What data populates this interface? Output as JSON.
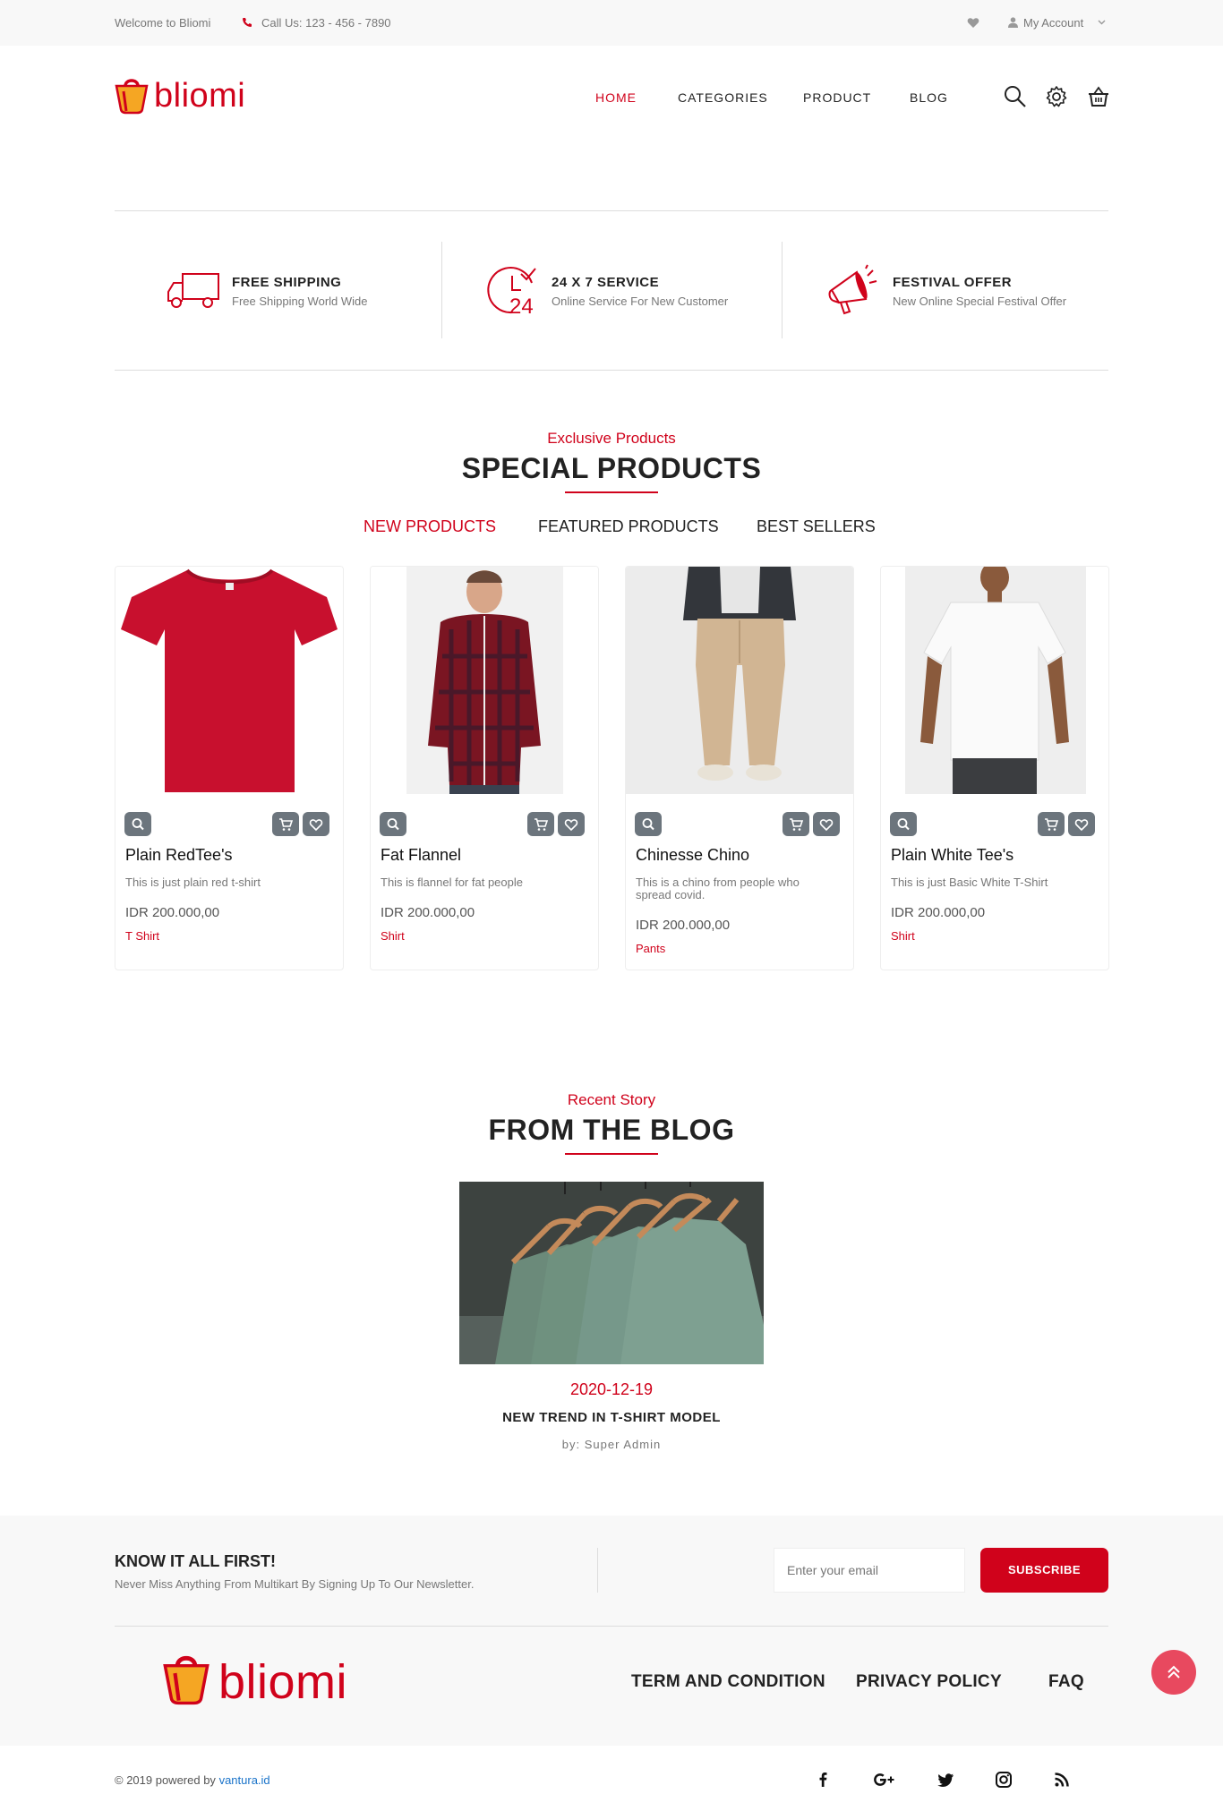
{
  "topbar": {
    "welcome": "Welcome to Bliomi",
    "phone": "Call Us: 123 - 456 - 7890",
    "account": "My Account"
  },
  "brand": {
    "name": "bliomi",
    "color": "#d0021b"
  },
  "nav": {
    "items": [
      {
        "label": "HOME",
        "active": true
      },
      {
        "label": "CATEGORIES",
        "active": false
      },
      {
        "label": "PRODUCT",
        "active": false
      },
      {
        "label": "BLOG",
        "active": false
      }
    ],
    "icons": [
      "search-icon",
      "gear-icon",
      "basket-icon"
    ]
  },
  "features": [
    {
      "title": "FREE SHIPPING",
      "subtitle": "Free Shipping World Wide",
      "icon": "truck-icon"
    },
    {
      "title": "24 X 7 SERVICE",
      "subtitle": "Online Service For New Customer",
      "icon": "clock-24-icon"
    },
    {
      "title": "FESTIVAL OFFER",
      "subtitle": "New Online Special Festival Offer",
      "icon": "megaphone-icon"
    }
  ],
  "special": {
    "subtitle": "Exclusive Products",
    "title": "SPECIAL PRODUCTS",
    "tabs": [
      {
        "label": "NEW PRODUCTS",
        "active": true
      },
      {
        "label": "FEATURED PRODUCTS",
        "active": false
      },
      {
        "label": "BEST SELLERS",
        "active": false
      }
    ],
    "products": [
      {
        "name": "Plain RedTee's",
        "desc": "This is just plain red t-shirt",
        "price": "IDR 200.000,00",
        "category": "T Shirt"
      },
      {
        "name": "Fat Flannel",
        "desc": "This is flannel for fat people",
        "price": "IDR 200.000,00",
        "category": "Shirt"
      },
      {
        "name": "Chinesse Chino",
        "desc": "This is a chino from people who spread covid.",
        "price": "IDR 200.000,00",
        "category": "Pants"
      },
      {
        "name": "Plain White Tee's",
        "desc": "This is just Basic White T-Shirt",
        "price": "IDR 200.000,00",
        "category": "Shirt"
      }
    ]
  },
  "blog": {
    "subtitle": "Recent Story",
    "title": "FROM THE BLOG",
    "post": {
      "date": "2020-12-19",
      "title": "NEW TREND IN T-SHIRT MODEL",
      "author": "by: Super Admin"
    }
  },
  "newsletter": {
    "title": "KNOW IT ALL FIRST!",
    "text": "Never Miss Anything From Multikart By Signing Up To Our Newsletter.",
    "placeholder": "Enter your email",
    "button": "SUBSCRIBE"
  },
  "footer": {
    "links": [
      "TERM AND CONDITION",
      "PRIVACY POLICY",
      "FAQ"
    ],
    "copyright": "© 2019 powered by",
    "powered_link": "vantura.id",
    "social": [
      "facebook-icon",
      "google-plus-icon",
      "twitter-icon",
      "instagram-icon",
      "rss-icon"
    ]
  }
}
